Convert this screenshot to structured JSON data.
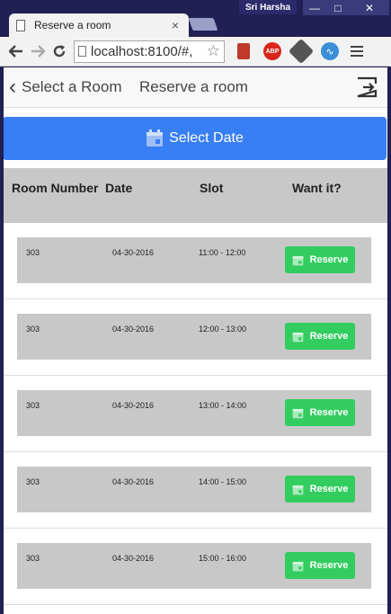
{
  "browser": {
    "user_name": "Sri Harsha",
    "tab_title": "Reserve a room",
    "tab_close": "×",
    "window_controls": {
      "minimize": "—",
      "maximize": "□",
      "close": "✕"
    },
    "url": "localhost:8100/#,",
    "extensions": {
      "abp_label": "ABP"
    },
    "icons": [
      "back-arrow-icon",
      "forward-arrow-icon",
      "reload-icon",
      "star-icon",
      "menu-icon"
    ]
  },
  "header": {
    "back_label": "Select a Room",
    "title": "Reserve a room"
  },
  "select_date_button": "Select Date",
  "table": {
    "columns": [
      "Room Number",
      "Date",
      "Slot",
      "Want it?"
    ],
    "rows": [
      {
        "room": "303",
        "date": "04-30-2016",
        "slot": "11:00 - 12:00",
        "action": "Reserve"
      },
      {
        "room": "303",
        "date": "04-30-2016",
        "slot": "12:00 - 13:00",
        "action": "Reserve"
      },
      {
        "room": "303",
        "date": "04-30-2016",
        "slot": "13:00 - 14:00",
        "action": "Reserve"
      },
      {
        "room": "303",
        "date": "04-30-2016",
        "slot": "14:00 - 15:00",
        "action": "Reserve"
      },
      {
        "room": "303",
        "date": "04-30-2016",
        "slot": "15:00 - 16:00",
        "action": "Reserve"
      }
    ]
  },
  "colors": {
    "primary": "#387ef5",
    "balanced": "#33cd5f",
    "row_bg": "#c8c8c8"
  }
}
